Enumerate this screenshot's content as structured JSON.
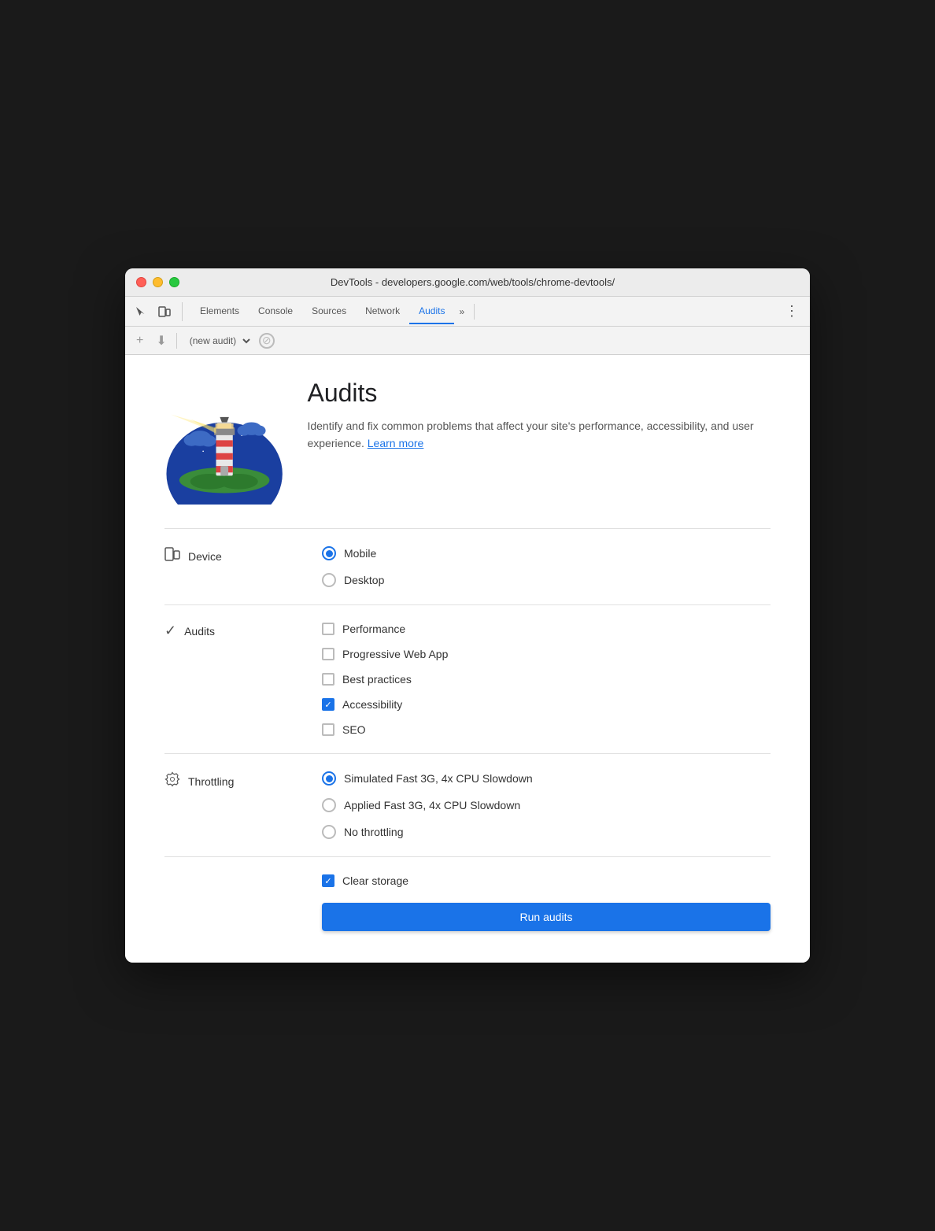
{
  "window": {
    "title": "DevTools - developers.google.com/web/tools/chrome-devtools/"
  },
  "tabs": {
    "elements": "Elements",
    "console": "Console",
    "sources": "Sources",
    "network": "Network",
    "audits": "Audits",
    "overflow": "»"
  },
  "toolbar": {
    "audit_select_value": "(new audit)",
    "add_label": "+",
    "download_label": "⬇"
  },
  "hero": {
    "title": "Audits",
    "description": "Identify and fix common problems that affect your site's performance, accessibility, and user experience.",
    "learn_more": "Learn more"
  },
  "device": {
    "label": "Device",
    "options": [
      {
        "id": "mobile",
        "label": "Mobile",
        "checked": true
      },
      {
        "id": "desktop",
        "label": "Desktop",
        "checked": false
      }
    ]
  },
  "audits": {
    "label": "Audits",
    "options": [
      {
        "id": "performance",
        "label": "Performance",
        "checked": false
      },
      {
        "id": "pwa",
        "label": "Progressive Web App",
        "checked": false
      },
      {
        "id": "best-practices",
        "label": "Best practices",
        "checked": false
      },
      {
        "id": "accessibility",
        "label": "Accessibility",
        "checked": true
      },
      {
        "id": "seo",
        "label": "SEO",
        "checked": false
      }
    ]
  },
  "throttling": {
    "label": "Throttling",
    "options": [
      {
        "id": "sim-fast-3g",
        "label": "Simulated Fast 3G, 4x CPU Slowdown",
        "checked": true
      },
      {
        "id": "applied-fast-3g",
        "label": "Applied Fast 3G, 4x CPU Slowdown",
        "checked": false
      },
      {
        "id": "no-throttling",
        "label": "No throttling",
        "checked": false
      }
    ]
  },
  "clear_storage": {
    "label": "Clear storage",
    "checked": true
  },
  "run_button": {
    "label": "Run audits"
  }
}
